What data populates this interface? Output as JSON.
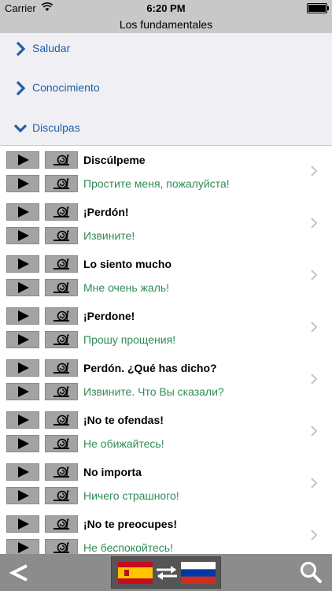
{
  "status_bar": {
    "carrier": "Carrier",
    "time": "6:20 PM"
  },
  "title": "Los fundamentales",
  "sections": [
    {
      "label": "Saludar",
      "expanded": false
    },
    {
      "label": "Conocimiento",
      "expanded": false
    },
    {
      "label": "Disculpas",
      "expanded": true
    }
  ],
  "phrases": [
    {
      "es": "Discúlpeme",
      "ru": "Простите меня, пожалуйста!"
    },
    {
      "es": "¡Perdón!",
      "ru": "Извините!"
    },
    {
      "es": "Lo siento mucho",
      "ru": "Мне очень жаль!"
    },
    {
      "es": "¡Perdone!",
      "ru": "Прошу прощения!"
    },
    {
      "es": "Perdón. ¿Qué has dicho?",
      "ru": "Извините. Что Вы сказали?"
    },
    {
      "es": "¡No te ofendas!",
      "ru": "Не обижайтесь!"
    },
    {
      "es": "No importa",
      "ru": "Ничего страшного!"
    },
    {
      "es": "¡No te preocupes!",
      "ru": "Не беспокойтесь!"
    }
  ],
  "icons": {
    "play": "play-icon",
    "slow": "snail-icon",
    "disclosure": "chevron-right-icon",
    "back": "back-arrow-icon",
    "swap": "swap-arrows-icon",
    "search": "search-icon"
  },
  "colors": {
    "section_label": "#1e5fa8",
    "translation": "#2e8b57",
    "bar": "#c8c8c8",
    "toolbar": "#8c8c8c"
  }
}
